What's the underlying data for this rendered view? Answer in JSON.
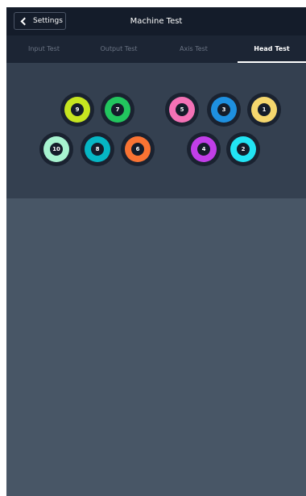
{
  "header": {
    "back_label": "Settings",
    "title": "Machine Test"
  },
  "tabs": [
    {
      "label": "Input Test",
      "active": false
    },
    {
      "label": "Output Test",
      "active": false
    },
    {
      "label": "Axis Test",
      "active": false
    },
    {
      "label": "Head Test",
      "active": true
    }
  ],
  "heads": [
    {
      "number": "9",
      "color": "#c6e520"
    },
    {
      "number": "7",
      "color": "#22c55e"
    },
    {
      "number": "5",
      "color": "#f472b6"
    },
    {
      "number": "3",
      "color": "#1e90e0"
    },
    {
      "number": "1",
      "color": "#f5d76e"
    },
    {
      "number": "10",
      "color": "#a7f3d0"
    },
    {
      "number": "8",
      "color": "#06b6c4"
    },
    {
      "number": "6",
      "color": "#f97333"
    },
    {
      "number": "4",
      "color": "#c13ee8"
    },
    {
      "number": "2",
      "color": "#22e4f4"
    }
  ]
}
